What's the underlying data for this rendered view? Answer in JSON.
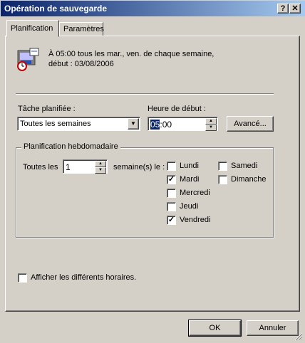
{
  "window": {
    "title": "Opération de sauvegarde",
    "help_label": "?",
    "close_label": "✕"
  },
  "tabs": [
    {
      "label": "Planification",
      "active": true
    },
    {
      "label": "Paramètres",
      "active": false
    }
  ],
  "summary": {
    "line1": "À 05:00 tous les mar., ven. de chaque semaine,",
    "line2": "début : 03/08/2006"
  },
  "schedule": {
    "task_label": "Tâche planifiée :",
    "task_value": "Toutes les semaines",
    "start_label": "Heure de début :",
    "start_hour": "05",
    "start_rest": ":00",
    "advanced_label": "Avancé..."
  },
  "weekly": {
    "legend": "Planification hebdomadaire",
    "every_label": "Toutes les",
    "every_value": "1",
    "weeks_label": "semaine(s) le :",
    "days": [
      {
        "label": "Lundi",
        "checked": false
      },
      {
        "label": "Mardi",
        "checked": true
      },
      {
        "label": "Mercredi",
        "checked": false
      },
      {
        "label": "Jeudi",
        "checked": false
      },
      {
        "label": "Vendredi",
        "checked": true
      },
      {
        "label": "Samedi",
        "checked": false
      },
      {
        "label": "Dimanche",
        "checked": false
      }
    ]
  },
  "multiple_label": "Afficher les différents horaires.",
  "multiple_checked": false,
  "footer": {
    "ok_label": "OK",
    "cancel_label": "Annuler"
  },
  "colors": {
    "titlebar_start": "#0a246a",
    "titlebar_end": "#a6caf0",
    "face": "#d4d0c8",
    "selection": "#0a246a"
  }
}
